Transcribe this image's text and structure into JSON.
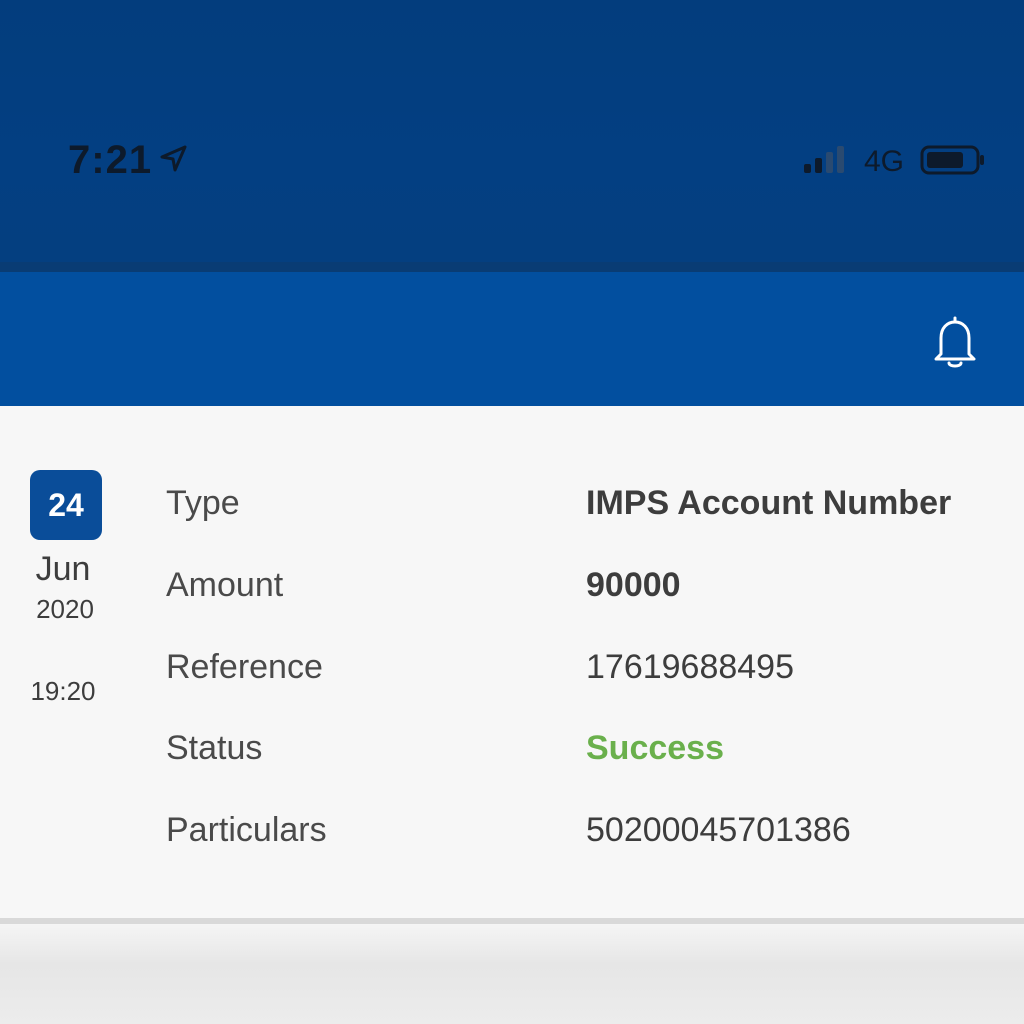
{
  "status_bar": {
    "time": "7:21",
    "network": "4G",
    "icons": [
      "location-arrow-icon",
      "signal-bars-icon",
      "battery-icon"
    ]
  },
  "app_bar": {
    "icons": [
      "bell-icon"
    ],
    "color": "#024f9f"
  },
  "transaction": {
    "date": {
      "day": "24",
      "month": "Jun",
      "year": "2020",
      "time": "19:20"
    },
    "rows": [
      {
        "label": "Type",
        "value": "IMPS Account Number"
      },
      {
        "label": "Amount",
        "value": "90000"
      },
      {
        "label": "Reference",
        "value": "17619688495"
      },
      {
        "label": "Status",
        "value": "Success"
      },
      {
        "label": "Particulars",
        "value": "50200045701386"
      }
    ],
    "status_color": "#6ab04c",
    "badge_color": "#0a4d99"
  }
}
